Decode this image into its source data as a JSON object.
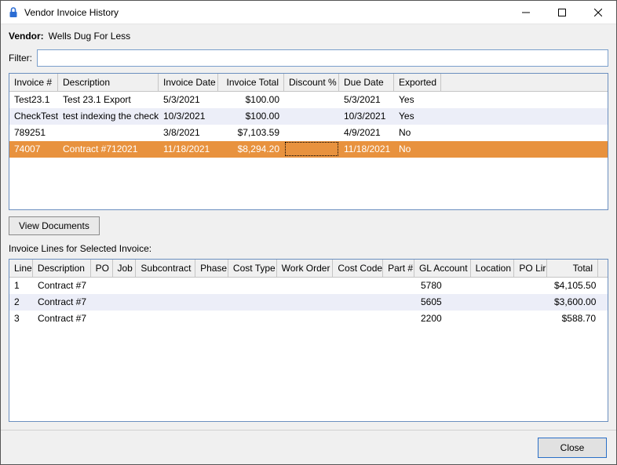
{
  "window": {
    "title": "Vendor Invoice History"
  },
  "vendor": {
    "label": "Vendor:",
    "name": "Wells Dug For Less"
  },
  "filter": {
    "label": "Filter:",
    "value": ""
  },
  "invoice_grid": {
    "headers": {
      "invoice_no": "Invoice #",
      "description": "Description",
      "invoice_date": "Invoice Date",
      "invoice_total": "Invoice Total",
      "discount_pct": "Discount %",
      "due_date": "Due Date",
      "exported": "Exported"
    },
    "rows": [
      {
        "invoice_no": "Test23.1",
        "description": "Test 23.1 Export",
        "invoice_date": "5/3/2021",
        "invoice_total": "$100.00",
        "discount_pct": "",
        "due_date": "5/3/2021",
        "exported": "Yes"
      },
      {
        "invoice_no": "CheckTest",
        "description": "test indexing the check",
        "invoice_date": "10/3/2021",
        "invoice_total": "$100.00",
        "discount_pct": "",
        "due_date": "10/3/2021",
        "exported": "Yes"
      },
      {
        "invoice_no": "789251",
        "description": "",
        "invoice_date": "3/8/2021",
        "invoice_total": "$7,103.59",
        "discount_pct": "",
        "due_date": "4/9/2021",
        "exported": "No"
      },
      {
        "invoice_no": "74007",
        "description": "Contract #712021",
        "invoice_date": "11/18/2021",
        "invoice_total": "$8,294.20",
        "discount_pct": "",
        "due_date": "11/18/2021",
        "exported": "No"
      }
    ]
  },
  "view_documents_label": "View Documents",
  "lines_section_label": "Invoice Lines for Selected Invoice:",
  "lines_grid": {
    "headers": {
      "line": "Line",
      "description": "Description",
      "po": "PO",
      "job": "Job",
      "subcontract": "Subcontract",
      "phase": "Phase",
      "cost_type": "Cost Type",
      "work_order": "Work Order",
      "cost_code": "Cost Code",
      "part_no": "Part #",
      "gl_account": "GL Account",
      "location": "Location",
      "po_lir": "PO Lir",
      "total": "Total"
    },
    "rows": [
      {
        "line": "1",
        "description": "Contract #7",
        "po": "",
        "job": "",
        "subcontract": "",
        "phase": "",
        "cost_type": "",
        "work_order": "",
        "cost_code": "",
        "part_no": "",
        "gl_account": "5780",
        "location": "",
        "po_lir": "",
        "total": "$4,105.50"
      },
      {
        "line": "2",
        "description": "Contract #7",
        "po": "",
        "job": "",
        "subcontract": "",
        "phase": "",
        "cost_type": "",
        "work_order": "",
        "cost_code": "",
        "part_no": "",
        "gl_account": "5605",
        "location": "",
        "po_lir": "",
        "total": "$3,600.00"
      },
      {
        "line": "3",
        "description": "Contract #7",
        "po": "",
        "job": "",
        "subcontract": "",
        "phase": "",
        "cost_type": "",
        "work_order": "",
        "cost_code": "",
        "part_no": "",
        "gl_account": "2200",
        "location": "",
        "po_lir": "",
        "total": "$588.70"
      }
    ]
  },
  "close_label": "Close"
}
